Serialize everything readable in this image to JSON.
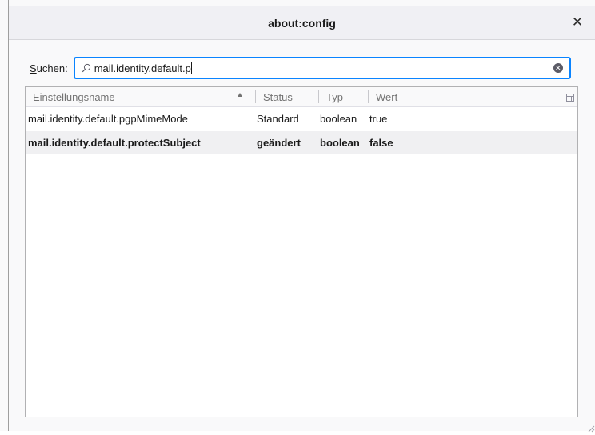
{
  "window": {
    "title": "about:config",
    "close_glyph": "✕"
  },
  "search": {
    "label_accel": "S",
    "label_rest": "uchen:",
    "value": "mail.identity.default.p",
    "clear_glyph": "✕"
  },
  "table": {
    "columns": [
      {
        "label": "Einstellungsname"
      },
      {
        "label": "Status"
      },
      {
        "label": "Typ"
      },
      {
        "label": "Wert"
      }
    ],
    "rows": [
      {
        "name": "mail.identity.default.pgpMimeMode",
        "status": "Standard",
        "type": "boolean",
        "value": "true",
        "modified": false
      },
      {
        "name": "mail.identity.default.protectSubject",
        "status": "geändert",
        "type": "boolean",
        "value": "false",
        "modified": true
      }
    ]
  },
  "colors": {
    "focus_accent": "#0a84ff",
    "alt_row": "#f0f0f2"
  },
  "icons": {
    "search": "search-icon",
    "clear": "clear-search-icon",
    "close": "close-icon",
    "sort": "sort-ascending-icon",
    "column_picker": "column-picker-icon",
    "resize": "resize-grip-icon"
  }
}
